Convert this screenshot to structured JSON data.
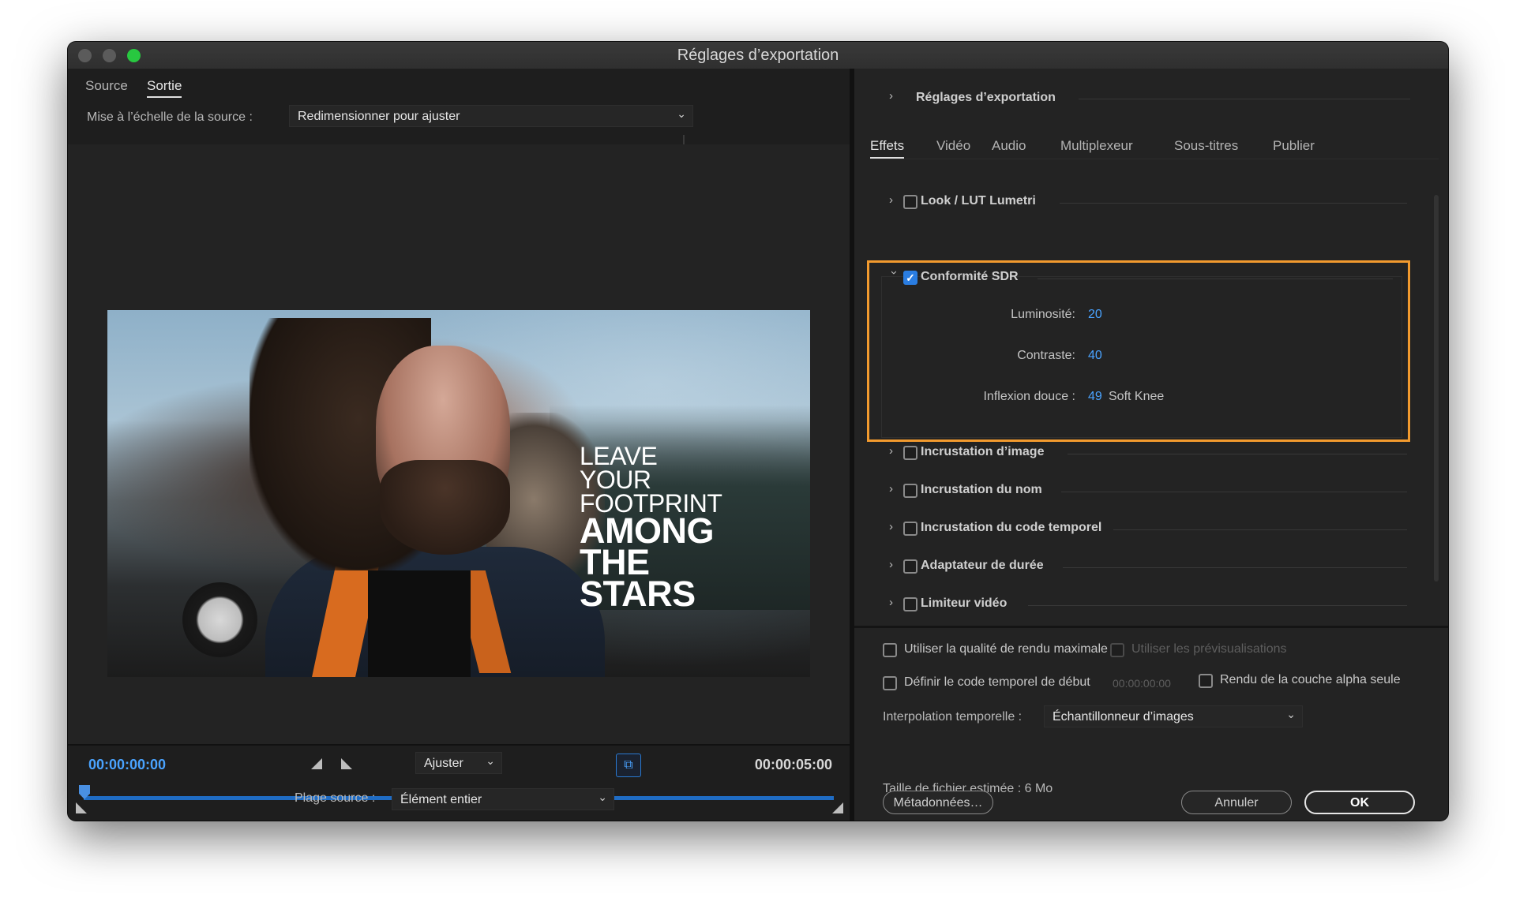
{
  "window": {
    "title": "Réglages d’exportation"
  },
  "left": {
    "tabs": [
      {
        "label": "Source",
        "active": false
      },
      {
        "label": "Sortie",
        "active": true
      }
    ],
    "scale": {
      "label": "Mise à l’échelle de la source :",
      "value": "Redimensionner pour ajuster"
    },
    "preview": {
      "lines_light": [
        "LEAVE",
        "YOUR",
        "FOOTPRINT"
      ],
      "lines_bold": [
        "AMONG",
        "THE",
        "STARS"
      ]
    },
    "timeline": {
      "start": "00:00:00:00",
      "end": "00:00:05:00",
      "fit_value": "Ajuster",
      "source_range_label": "Plage source :",
      "source_range_value": "Élément entier"
    }
  },
  "right": {
    "section_title": "Réglages d’exportation",
    "tabs": [
      {
        "label": "Effets",
        "active": true
      },
      {
        "label": "Vidéo",
        "active": false
      },
      {
        "label": "Audio",
        "active": false
      },
      {
        "label": "Multiplexeur",
        "active": false
      },
      {
        "label": "Sous-titres",
        "active": false
      },
      {
        "label": "Publier",
        "active": false
      }
    ],
    "effects": {
      "lumetri": {
        "label": "Look / LUT Lumetri",
        "checked": false
      },
      "sdr": {
        "label": "Conformité SDR",
        "checked": true,
        "params": {
          "brightness_label": "Luminosité:",
          "brightness_value": "20",
          "contrast_label": "Contraste:",
          "contrast_value": "40",
          "knee_label": "Inflexion douce :",
          "knee_value": "49",
          "knee_extra": "Soft Knee"
        }
      },
      "image_overlay": {
        "label": "Incrustation d’image",
        "checked": false
      },
      "name_overlay": {
        "label": "Incrustation du nom",
        "checked": false
      },
      "timecode_overlay": {
        "label": "Incrustation du code temporel",
        "checked": false
      },
      "duration_adapter": {
        "label": "Adaptateur de durée",
        "checked": false
      },
      "video_limiter": {
        "label": "Limiteur vidéo",
        "checked": false
      }
    },
    "options": {
      "max_quality": "Utiliser la qualité de rendu maximale",
      "use_previews": "Utiliser les prévisualisations",
      "set_start_tc": "Définir le code temporel de début",
      "start_tc_value": "00:00:00:00",
      "alpha_only": "Rendu de la couche alpha seule",
      "interp_label": "Interpolation temporelle :",
      "interp_value": "Échantillonneur d’images",
      "file_size": "Taille de fichier estimée : 6 Mo"
    },
    "buttons": {
      "metadata": "Métadonnées…",
      "cancel": "Annuler",
      "ok": "OK"
    }
  },
  "colors": {
    "accent_blue": "#4aa3ff",
    "highlight_orange": "#f29a2e",
    "checkbox_blue": "#2a7de1"
  }
}
